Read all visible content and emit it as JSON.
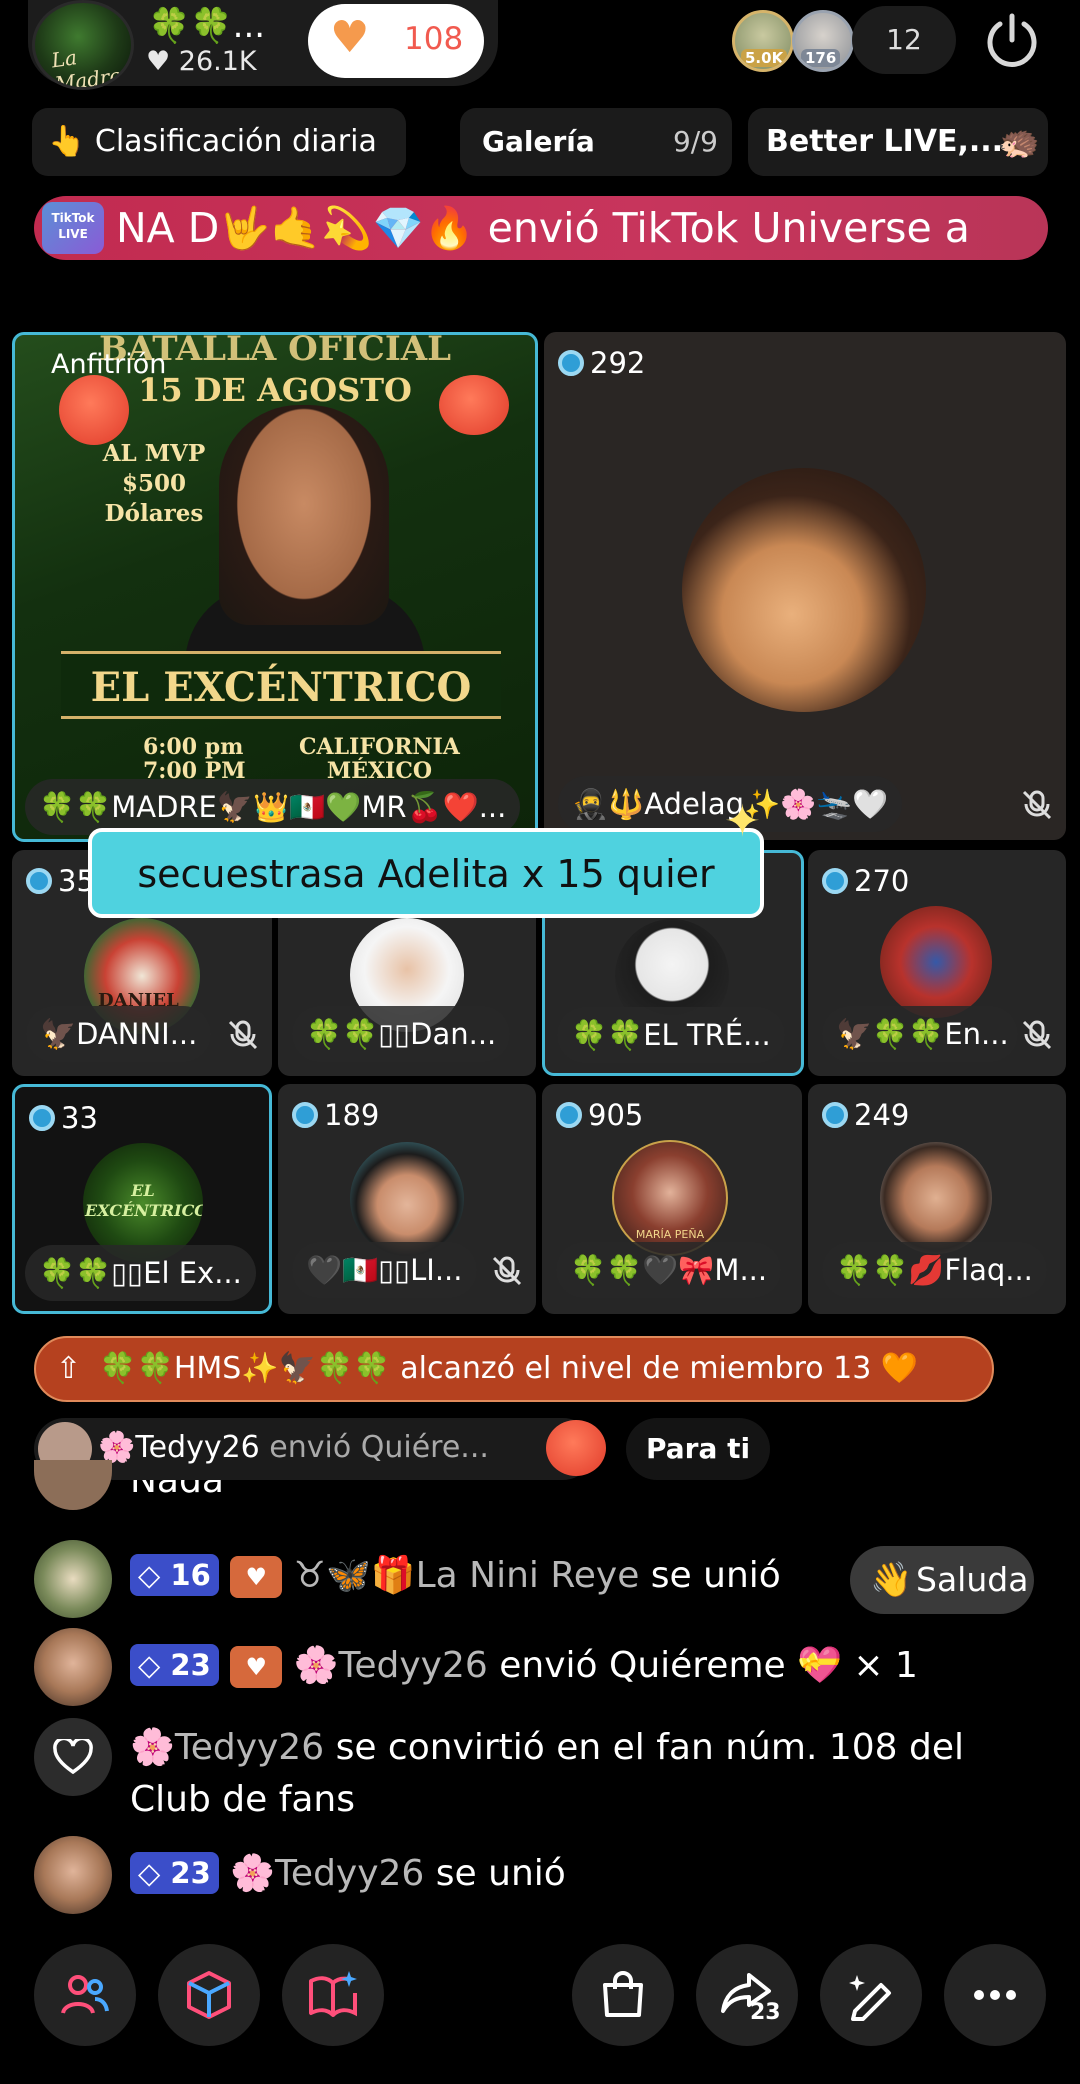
{
  "header": {
    "host_name": "🍀🍀...",
    "likes": "♥ 26.1K",
    "fan_count": "108",
    "viewer_badges": [
      "5.0K",
      "176"
    ],
    "viewer_count": "12"
  },
  "chips": {
    "ranking": "👆 Clasificación diaria",
    "gallery": "Galería",
    "gallery_count": "9/9",
    "better_live": "Better LIVE,..."
  },
  "banner": {
    "logo": "TikTok LIVE",
    "text": "NA D🤟🤙💫💎🔥 envió TikTok Universe a"
  },
  "host_tile": {
    "label": "Anfitrión",
    "poster_title": "15 DE AGOSTO",
    "poster_top": "BATALLA OFICIAL",
    "poster_mvp": "AL MVP $500 Dólares",
    "poster_main": "EL EXCÉNTRICO",
    "poster_time": "6:00 pm\n7:00 PM",
    "poster_loc": "CALIFORNIA\nMÉXICO",
    "name": "🍀🍀MADRE🦅👑🇲🇽💚MR🍒❤️..."
  },
  "guest_tile": {
    "count": "292",
    "name": "🥷🔱Adelag✨🌸🛬🤍"
  },
  "comment_banner": "secuestrasa Adelita x 15 quier",
  "small_tiles": [
    {
      "count": "35",
      "name": "🦅DANNI...",
      "muted": true
    },
    {
      "count": "",
      "name": "🍀🍀▯▯Dan...",
      "muted": false
    },
    {
      "count": "",
      "name": "🍀🍀EL TRÉ...",
      "muted": false
    },
    {
      "count": "270",
      "name": "🦅🍀🍀En...",
      "muted": true
    },
    {
      "count": "33",
      "name": "🍀🍀▯▯El Ex...",
      "muted": false
    },
    {
      "count": "189",
      "name": "🖤🇲🇽▯▯LI...",
      "muted": true
    },
    {
      "count": "905",
      "name": "🍀🍀🖤🎀M...",
      "muted": false
    },
    {
      "count": "249",
      "name": "🍀🍀💋Flaq...",
      "muted": false
    }
  ],
  "tile_labels": {
    "danniel": "DANIEL",
    "excentrico": "EL EXCÉNTRICO",
    "maria": "MARÍA PEÑA"
  },
  "level_bar": "🍀🍀HMS✨🦅🍀🍀 alcanzó el nivel de miembro 13 🧡",
  "gift_row": {
    "user": "🌸Tedyy26",
    "text": " envió Quiére..."
  },
  "para_ti": "Para ti",
  "chat": {
    "partial": "Nada",
    "row1": {
      "level": "16",
      "user": "♉🦋🎁La Nini Reye",
      "action": " se unió"
    },
    "saluda": "Saluda",
    "row2": {
      "level": "23",
      "user": "🌸Tedyy26",
      "action": " envió Quiéreme 💝 × 1"
    },
    "row3": {
      "user": "🌸Tedyy26",
      "action": " se convirtió en el fan núm. 108 del",
      "action2": "Club de fans"
    },
    "row4": {
      "level": "23",
      "user": "🌸Tedyy26",
      "action": " se unió"
    }
  },
  "bottom_bar": {
    "share_count": "23"
  },
  "colors": {
    "accent_cyan": "#46b9d6",
    "banner_red": "#c22b50",
    "level_orange": "#b5411f",
    "level_blue": "#3b4ec9",
    "icon_pink": "#ff4f7a"
  }
}
